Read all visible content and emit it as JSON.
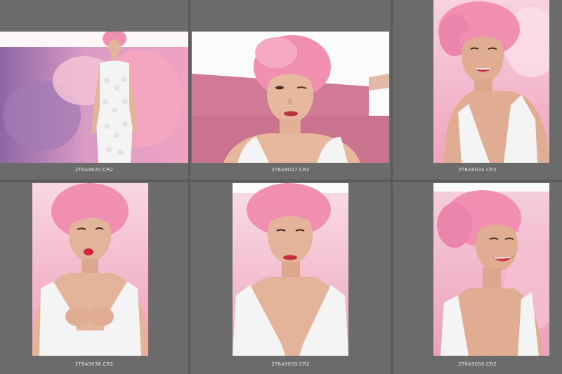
{
  "thumbnails": [
    {
      "filename": "2T6A9020.CR2",
      "orientation": "landscape",
      "selected": false,
      "colors": {
        "background": "#f7c6d9",
        "backdrop": "#b27bb0",
        "hair": "#f08fb2",
        "dress": "#f4f4f4",
        "skin": "#e4b49a",
        "lips": "#d2303f"
      }
    },
    {
      "filename": "2T6A9027.CR2",
      "orientation": "landscape",
      "selected": false,
      "colors": {
        "background": "#fbfbfb",
        "backdrop": "#d07a98",
        "hair": "#f08fb2",
        "dress": "#f4f4f4",
        "skin": "#e7b79e",
        "lips": "#b8343d"
      }
    },
    {
      "filename": "2T6A9034.CR2",
      "orientation": "portrait",
      "selected": false,
      "colors": {
        "background": "#f5bfd1",
        "backdrop": "#f3a7c2",
        "hair": "#f08fb2",
        "dress": "#f4f4f4",
        "skin": "#e1ad92",
        "lips": "#c73545"
      }
    },
    {
      "filename": "2T6A9038.CR2",
      "orientation": "portrait",
      "selected": false,
      "colors": {
        "background": "#f2bfd1",
        "backdrop": "#efa2bb",
        "hair": "#f08fb2",
        "dress": "#f4f4f4",
        "skin": "#e4b49a",
        "lips": "#d1263e"
      }
    },
    {
      "filename": "2T6A9039.CR2",
      "orientation": "portrait",
      "selected": false,
      "colors": {
        "background": "#f3c5d4",
        "backdrop": "#eeaabf",
        "hair": "#f08fb2",
        "dress": "#f4f4f4",
        "skin": "#e5b39a",
        "lips": "#c3313f"
      }
    },
    {
      "filename": "2T6A9050.CR2",
      "orientation": "portrait",
      "selected": false,
      "colors": {
        "background": "#f3bed0",
        "backdrop": "#eea2bb",
        "hair": "#f08fb2",
        "dress": "#f4f4f4",
        "skin": "#e1ad92",
        "lips": "#c93a48"
      }
    }
  ]
}
